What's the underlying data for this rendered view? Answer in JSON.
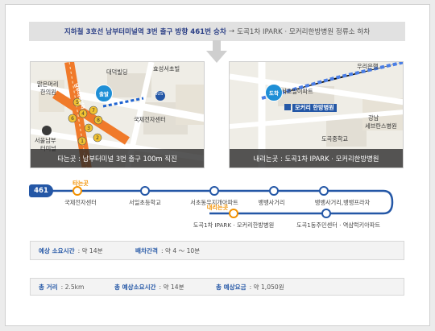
{
  "banner": {
    "lead": "지하철 3호선 남부터미널역 3번 출구 방향 461번 승차",
    "arrow": "→",
    "rest": "도곡1차 IPARK · 모커리한방병원 정류소 하차"
  },
  "map_left": {
    "caption": "타는곳 : 남부터미널 3번 출구 100m 직진",
    "bubble": "출발",
    "labels": [
      "대덕빌딩",
      "효성서초빌",
      "맑은머리",
      "한의원",
      "국제전자센터",
      "서울남부",
      "터미널",
      "BUS",
      "남부터미널역"
    ],
    "exit_numbers": [
      "4",
      "5",
      "6",
      "7",
      "8",
      "3",
      "2",
      "1"
    ]
  },
  "map_right": {
    "caption": "내리는곳 : 도곡1차 IPARK · 모커리한방병원",
    "bubble": "도착",
    "labels": [
      "서초빌이파트",
      "모커리 한방병원",
      "강남",
      "세브란스병원",
      "도곡중학교",
      "우리은행"
    ]
  },
  "route": {
    "number": "461",
    "board_tag": "타는곳",
    "alight_tag": "내리는곳",
    "top_stops": [
      "국제전자센터",
      "서일초등학교",
      "서초동우지개아파트",
      "뱅뱅사거리",
      "뱅뱅사거리,뱅뱅프라자"
    ],
    "bottom_stops": [
      "도곡1차 IPARK · 모커리한방병원",
      "도곡1동주민센터 · 역삼럭키아파트"
    ],
    "colors": {
      "line": "#2457a6",
      "accent": "#f29100"
    }
  },
  "info1": {
    "time_key": "예상 소요시간",
    "time_val": ": 약 14분",
    "interval_key": "배차간격",
    "interval_val": ": 약 4 ～ 10분"
  },
  "info2": {
    "distance_key": "총 거리",
    "distance_val": ": 2.5km",
    "total_time_key": "총 예상소요시간",
    "total_time_val": ": 약 14분",
    "fare_key": "총 예상요금",
    "fare_val": ": 약 1,050원"
  }
}
